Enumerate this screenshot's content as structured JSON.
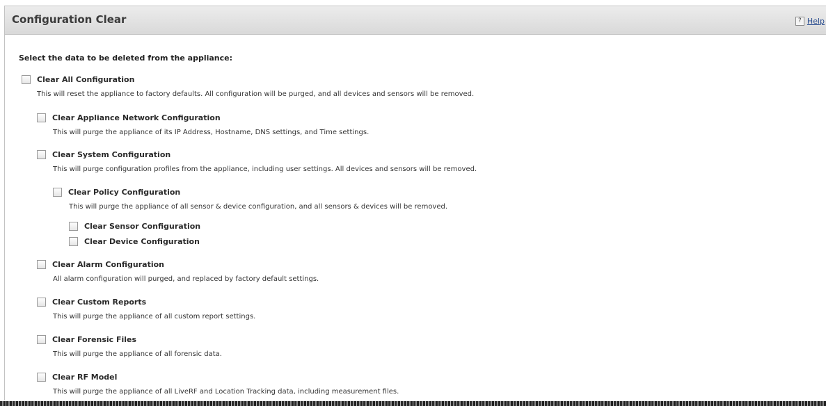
{
  "header": {
    "title": "Configuration Clear",
    "help_icon": "?",
    "help_label": "Help"
  },
  "intro": "Select the data to be deleted from the appliance:",
  "options": [
    {
      "label": "Clear All Configuration",
      "description": "This will reset the appliance to factory defaults. All configuration will be purged, and all devices and sensors will be removed.",
      "checked": false
    },
    {
      "label": "Clear Appliance Network Configuration",
      "description": "This will purge the appliance of its IP Address, Hostname, DNS settings, and Time settings.",
      "checked": false
    },
    {
      "label": "Clear System Configuration",
      "description": "This will purge configuration profiles from the appliance, including user settings. All devices and sensors will be removed.",
      "checked": false
    },
    {
      "label": "Clear Policy Configuration",
      "description": "This will purge the appliance of all sensor & device configuration, and all sensors & devices will be removed.",
      "checked": false
    },
    {
      "label": "Clear Sensor Configuration",
      "checked": false
    },
    {
      "label": "Clear Device Configuration",
      "checked": false
    },
    {
      "label": "Clear Alarm Configuration",
      "description": "All alarm configuration will purged, and replaced by factory default settings.",
      "checked": false
    },
    {
      "label": "Clear Custom Reports",
      "description": "This will purge the appliance of all custom report settings.",
      "checked": false
    },
    {
      "label": "Clear Forensic Files",
      "description": "This will purge the appliance of all forensic data.",
      "checked": false
    },
    {
      "label": "Clear RF Model",
      "description": "This will purge the appliance of all LiveRF and Location Tracking data, including measurement files.",
      "checked": false
    }
  ]
}
